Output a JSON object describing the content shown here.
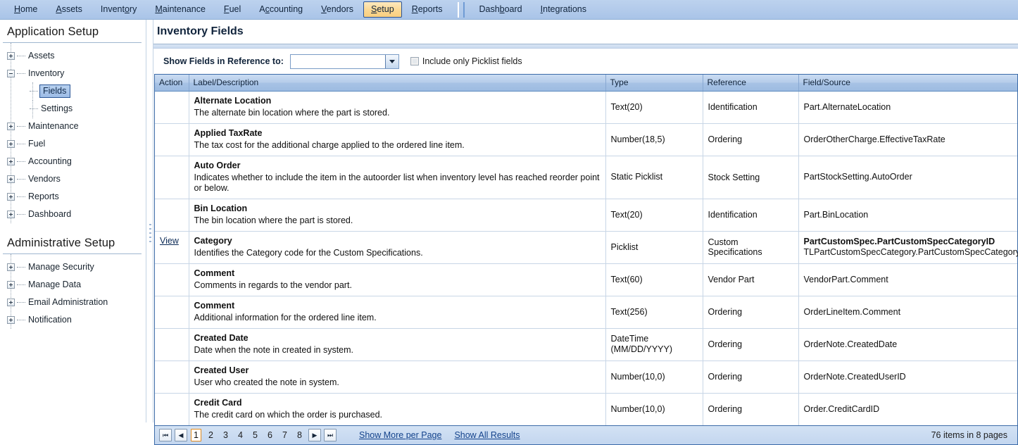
{
  "menubar": {
    "items": [
      {
        "label": "Home",
        "accel": "H",
        "active": false,
        "sep_before": false
      },
      {
        "label": "Assets",
        "accel": "A",
        "active": false,
        "sep_before": false
      },
      {
        "label": "Inventory",
        "accel": "o",
        "active": false,
        "sep_before": false
      },
      {
        "label": "Maintenance",
        "accel": "M",
        "active": false,
        "sep_before": false
      },
      {
        "label": "Fuel",
        "accel": "F",
        "active": false,
        "sep_before": false
      },
      {
        "label": "Accounting",
        "accel": "c",
        "active": false,
        "sep_before": false
      },
      {
        "label": "Vendors",
        "accel": "V",
        "active": false,
        "sep_before": false
      },
      {
        "label": "Setup",
        "accel": "S",
        "active": true,
        "sep_before": false
      },
      {
        "label": "Reports",
        "accel": "R",
        "active": false,
        "sep_before": false
      },
      {
        "label": "Dashboard",
        "accel": "b",
        "active": false,
        "sep_before": true
      },
      {
        "label": "Integrations",
        "accel": "I",
        "active": false,
        "sep_before": false
      }
    ]
  },
  "sidebar": {
    "section1_title": "Application Setup",
    "section2_title": "Administrative Setup",
    "tree1": [
      {
        "label": "Assets",
        "level": 1,
        "state": "collapsed",
        "selected": false
      },
      {
        "label": "Inventory",
        "level": 1,
        "state": "expanded",
        "selected": false
      },
      {
        "label": "Fields",
        "level": 2,
        "state": "leaf",
        "selected": true
      },
      {
        "label": "Settings",
        "level": 2,
        "state": "leaf",
        "selected": false
      },
      {
        "label": "Maintenance",
        "level": 1,
        "state": "collapsed",
        "selected": false
      },
      {
        "label": "Fuel",
        "level": 1,
        "state": "collapsed",
        "selected": false
      },
      {
        "label": "Accounting",
        "level": 1,
        "state": "collapsed",
        "selected": false
      },
      {
        "label": "Vendors",
        "level": 1,
        "state": "collapsed",
        "selected": false
      },
      {
        "label": "Reports",
        "level": 1,
        "state": "collapsed",
        "selected": false
      },
      {
        "label": "Dashboard",
        "level": 1,
        "state": "collapsed",
        "selected": false
      }
    ],
    "tree2": [
      {
        "label": "Manage Security",
        "level": 1,
        "state": "collapsed",
        "selected": false
      },
      {
        "label": "Manage Data",
        "level": 1,
        "state": "collapsed",
        "selected": false
      },
      {
        "label": "Email Administration",
        "level": 1,
        "state": "collapsed",
        "selected": false
      },
      {
        "label": "Notification",
        "level": 1,
        "state": "collapsed",
        "selected": false
      }
    ]
  },
  "page": {
    "title": "Inventory Fields"
  },
  "filter": {
    "label": "Show Fields in Reference to:",
    "combo_value": "",
    "combo_placeholder": "",
    "checkbox_label": "Include only Picklist fields",
    "checkbox_checked": false
  },
  "grid": {
    "columns": [
      "Action",
      "Label/Description",
      "Type",
      "Reference",
      "Field/Source"
    ],
    "rows": [
      {
        "action": "",
        "label": "Alternate Location",
        "description": "The alternate bin location where the part is stored.",
        "type": "Text(20)",
        "reference": "Identification",
        "source_bold": "",
        "source": "Part.AlternateLocation"
      },
      {
        "action": "",
        "label": "Applied TaxRate",
        "description": "The tax cost for the additional charge applied to the ordered line item.",
        "type": "Number(18,5)",
        "reference": "Ordering",
        "source_bold": "",
        "source": "OrderOtherCharge.EffectiveTaxRate"
      },
      {
        "action": "",
        "label": "Auto Order",
        "description": "Indicates whether to include the item in the autoorder list when inventory level has reached reorder point or below.",
        "type": "Static Picklist",
        "reference": "Stock Setting",
        "source_bold": "",
        "source": "PartStockSetting.AutoOrder"
      },
      {
        "action": "",
        "label": "Bin Location",
        "description": "The bin location where the part is stored.",
        "type": "Text(20)",
        "reference": "Identification",
        "source_bold": "",
        "source": "Part.BinLocation"
      },
      {
        "action": "View",
        "label": "Category",
        "description": "Identifies the Category code for the Custom Specifications.",
        "type": "Picklist",
        "reference": "Custom Specifications",
        "source_bold": "PartCustomSpec.PartCustomSpecCategoryID",
        "source": "TLPartCustomSpecCategory.PartCustomSpecCategoryID"
      },
      {
        "action": "",
        "label": "Comment",
        "description": "Comments in regards to the vendor part.",
        "type": "Text(60)",
        "reference": "Vendor Part",
        "source_bold": "",
        "source": "VendorPart.Comment"
      },
      {
        "action": "",
        "label": "Comment",
        "description": "Additional information for the ordered line item.",
        "type": "Text(256)",
        "reference": "Ordering",
        "source_bold": "",
        "source": "OrderLineItem.Comment"
      },
      {
        "action": "",
        "label": "Created Date",
        "description": "Date when the note in created in system.",
        "type": "DateTime\n(MM/DD/YYYY)",
        "reference": "Ordering",
        "source_bold": "",
        "source": "OrderNote.CreatedDate"
      },
      {
        "action": "",
        "label": "Created User",
        "description": "User who created the note in system.",
        "type": "Number(10,0)",
        "reference": "Ordering",
        "source_bold": "",
        "source": "OrderNote.CreatedUserID"
      },
      {
        "action": "",
        "label": "Credit Card",
        "description": "The credit card on which the order is purchased.",
        "type": "Number(10,0)",
        "reference": "Ordering",
        "source_bold": "",
        "source": "Order.CreditCardID"
      }
    ]
  },
  "pager": {
    "first_label": "|◀",
    "prev_label": "◀",
    "next_label": "▶",
    "last_label": "▶|",
    "pages": [
      "1",
      "2",
      "3",
      "4",
      "5",
      "6",
      "7",
      "8"
    ],
    "current_page": "1",
    "show_more_label": "Show More per Page",
    "show_all_label": "Show All Results",
    "count_text": "76 items in 8 pages"
  }
}
